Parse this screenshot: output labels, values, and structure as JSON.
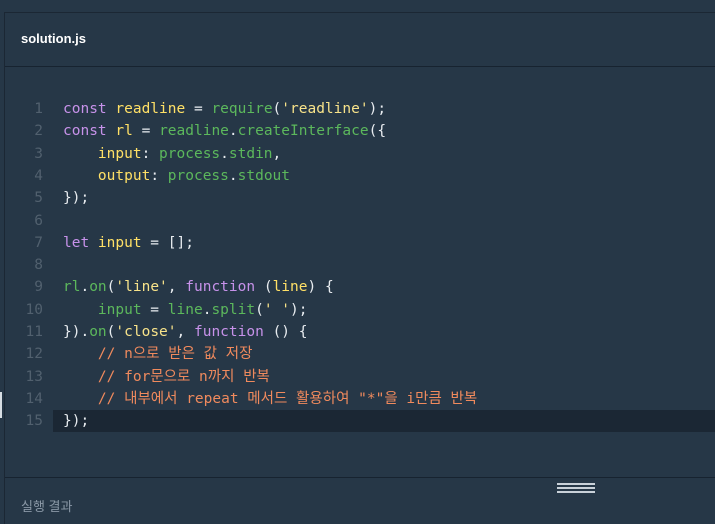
{
  "editor": {
    "filename": "solution.js",
    "lines": [
      {
        "n": "1",
        "tokens": [
          [
            "kw",
            "const "
          ],
          [
            "var",
            "readline"
          ],
          [
            "plain",
            " = "
          ],
          [
            "fn",
            "require"
          ],
          [
            "plain",
            "("
          ],
          [
            "str",
            "'readline'"
          ],
          [
            "plain",
            ");"
          ]
        ]
      },
      {
        "n": "2",
        "tokens": [
          [
            "kw",
            "const "
          ],
          [
            "var",
            "rl"
          ],
          [
            "plain",
            " = "
          ],
          [
            "fn",
            "readline"
          ],
          [
            "plain",
            "."
          ],
          [
            "fn",
            "createInterface"
          ],
          [
            "plain",
            "({"
          ]
        ]
      },
      {
        "n": "3",
        "tokens": [
          [
            "plain",
            "    "
          ],
          [
            "var",
            "input"
          ],
          [
            "plain",
            ": "
          ],
          [
            "fn",
            "process"
          ],
          [
            "plain",
            "."
          ],
          [
            "fn",
            "stdin"
          ],
          [
            "plain",
            ","
          ]
        ]
      },
      {
        "n": "4",
        "tokens": [
          [
            "plain",
            "    "
          ],
          [
            "var",
            "output"
          ],
          [
            "plain",
            ": "
          ],
          [
            "fn",
            "process"
          ],
          [
            "plain",
            "."
          ],
          [
            "fn",
            "stdout"
          ]
        ]
      },
      {
        "n": "5",
        "tokens": [
          [
            "plain",
            "});"
          ]
        ]
      },
      {
        "n": "6",
        "tokens": []
      },
      {
        "n": "7",
        "tokens": [
          [
            "kw",
            "let "
          ],
          [
            "var",
            "input"
          ],
          [
            "plain",
            " = [];"
          ]
        ]
      },
      {
        "n": "8",
        "tokens": []
      },
      {
        "n": "9",
        "tokens": [
          [
            "fn",
            "rl"
          ],
          [
            "plain",
            "."
          ],
          [
            "fn",
            "on"
          ],
          [
            "plain",
            "("
          ],
          [
            "str",
            "'line'"
          ],
          [
            "plain",
            ", "
          ],
          [
            "kw",
            "function "
          ],
          [
            "plain",
            "("
          ],
          [
            "var",
            "line"
          ],
          [
            "plain",
            ") {"
          ]
        ]
      },
      {
        "n": "10",
        "tokens": [
          [
            "plain",
            "    "
          ],
          [
            "fn",
            "input"
          ],
          [
            "plain",
            " = "
          ],
          [
            "fn",
            "line"
          ],
          [
            "plain",
            "."
          ],
          [
            "fn",
            "split"
          ],
          [
            "plain",
            "("
          ],
          [
            "str",
            "' '"
          ],
          [
            "plain",
            ");"
          ]
        ]
      },
      {
        "n": "11",
        "tokens": [
          [
            "plain",
            "})."
          ],
          [
            "fn",
            "on"
          ],
          [
            "plain",
            "("
          ],
          [
            "str",
            "'close'"
          ],
          [
            "plain",
            ", "
          ],
          [
            "kw",
            "function "
          ],
          [
            "plain",
            "() {"
          ]
        ]
      },
      {
        "n": "12",
        "tokens": [
          [
            "plain",
            "    "
          ],
          [
            "cm",
            "// n으로 받은 값 저장"
          ]
        ]
      },
      {
        "n": "13",
        "tokens": [
          [
            "plain",
            "    "
          ],
          [
            "cm",
            "// for문으로 n까지 반복"
          ]
        ]
      },
      {
        "n": "14",
        "tokens": [
          [
            "plain",
            "    "
          ],
          [
            "cm",
            "// 내부에서 repeat 메서드 활용하여 \"*\"을 i만큼 반복"
          ]
        ]
      },
      {
        "n": "15",
        "tokens": [
          [
            "plain",
            "});"
          ]
        ],
        "active": true
      }
    ]
  },
  "result": {
    "label": "실행 결과"
  },
  "colors": {
    "background": "#263747",
    "active_line": "#1b2734",
    "keyword": "#c792ea",
    "variable": "#ffe066",
    "function": "#5cb85c",
    "string": "#f8e38a",
    "comment": "#f08a5d"
  }
}
